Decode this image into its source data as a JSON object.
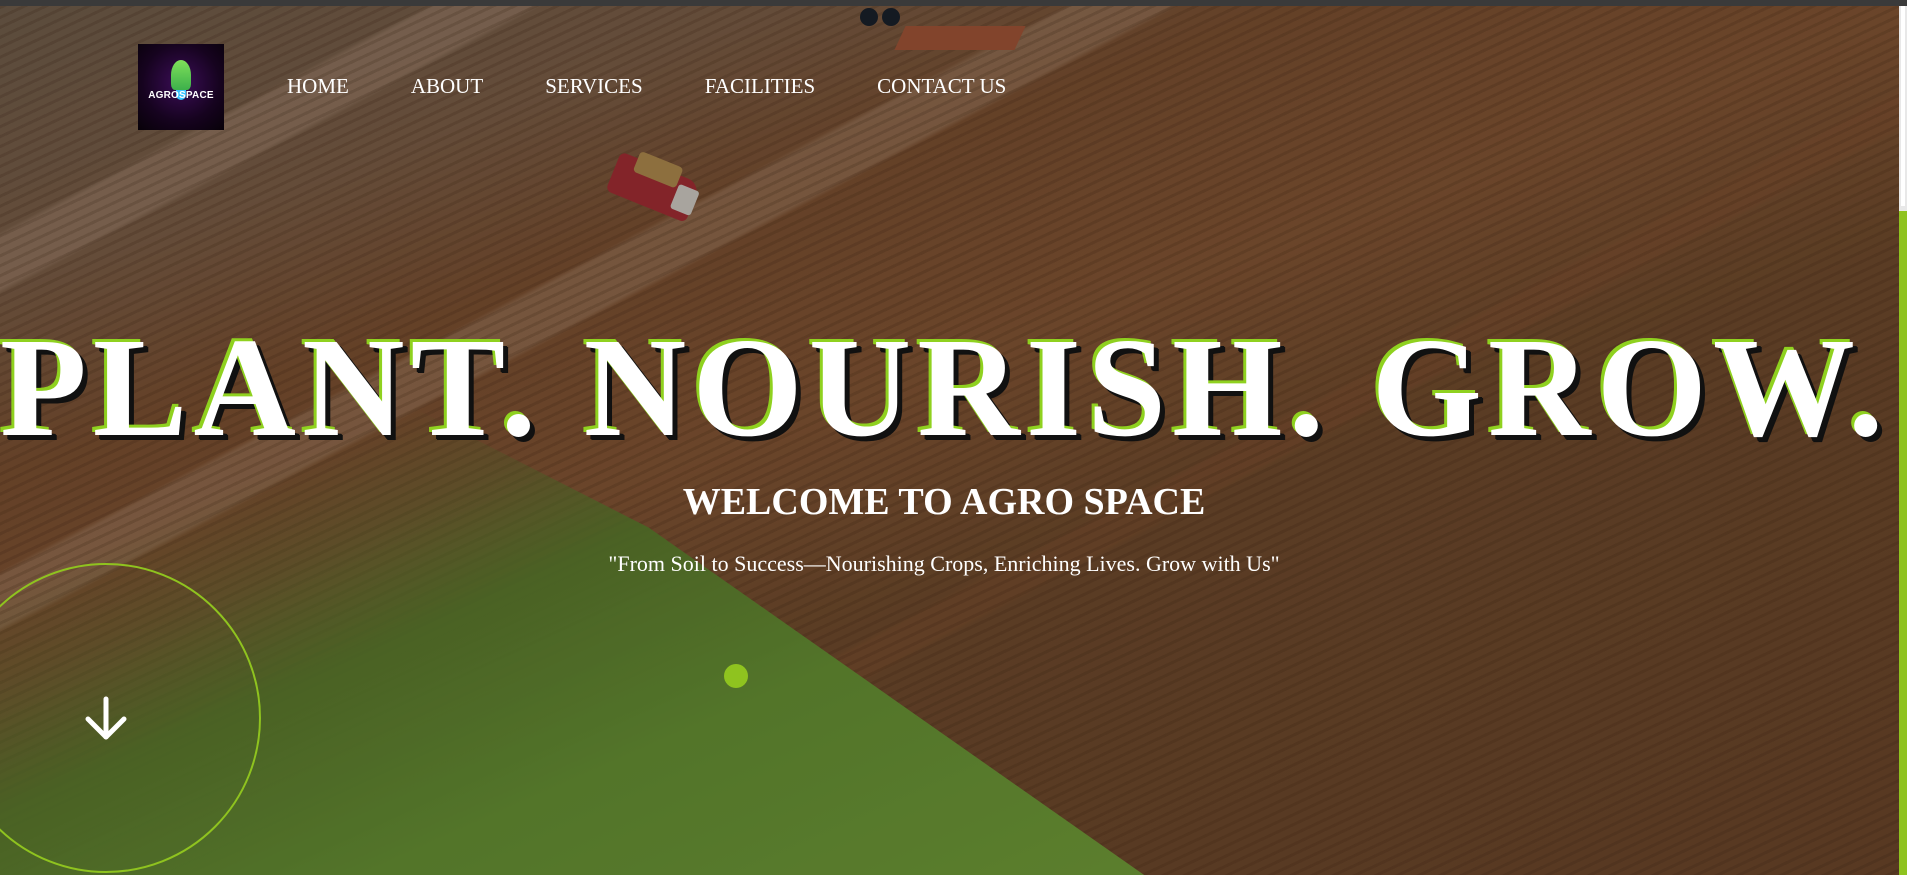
{
  "logo": {
    "text": "AGROSPACE"
  },
  "nav": {
    "items": [
      {
        "label": "HOME"
      },
      {
        "label": "ABOUT"
      },
      {
        "label": "SERVICES"
      },
      {
        "label": "FACILITIES"
      },
      {
        "label": "CONTACT US"
      }
    ]
  },
  "hero": {
    "headline": "PLANT. NOURISH. GROW.",
    "subtitle": "WELCOME TO AGRO SPACE",
    "tagline": "\"From Soil to Success—Nourishing Crops, Enriching Lives. Grow with Us\""
  },
  "icons": {
    "scroll_down": "arrow-down-icon",
    "logo_rocket": "rocket-icon"
  },
  "colors": {
    "accent": "#8fc31f",
    "text": "#ffffff",
    "headline_shadow": "#111111"
  }
}
